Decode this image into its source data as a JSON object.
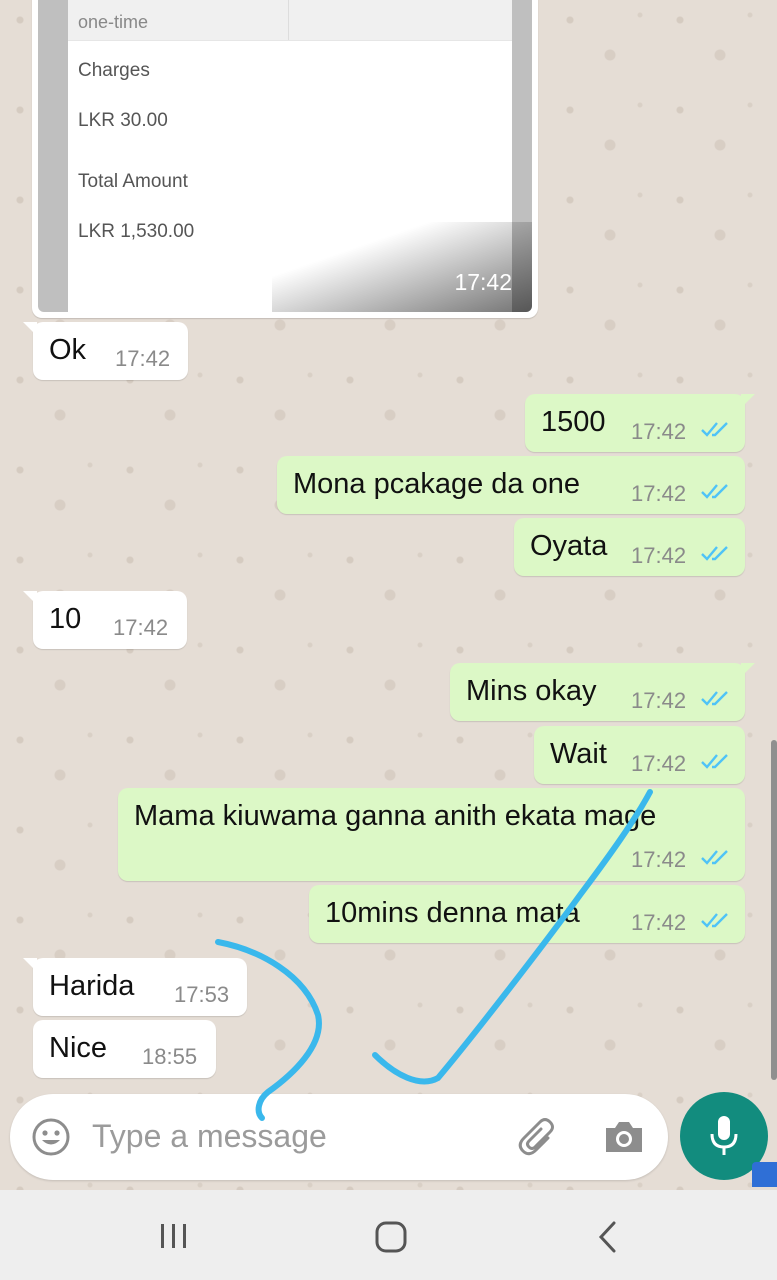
{
  "receipt": {
    "top_value": "one-time",
    "charges_label": "Charges",
    "charges_value": "LKR 30.00",
    "total_label": "Total Amount",
    "total_value": "LKR 1,530.00",
    "time": "17:42"
  },
  "messages": [
    {
      "text": "Ok",
      "time": "17:42",
      "dir": "in"
    },
    {
      "text": "1500",
      "time": "17:42",
      "dir": "out"
    },
    {
      "text": "Mona pcakage da one",
      "time": "17:42",
      "dir": "out"
    },
    {
      "text": "Oyata",
      "time": "17:42",
      "dir": "out"
    },
    {
      "text": "10",
      "time": "17:42",
      "dir": "in"
    },
    {
      "text": "Mins okay",
      "time": "17:42",
      "dir": "out"
    },
    {
      "text": "Wait",
      "time": "17:42",
      "dir": "out"
    },
    {
      "text": "Mama kiuwama ganna anith ekata mage",
      "time": "17:42",
      "dir": "out"
    },
    {
      "text": "10mins denna mata",
      "time": "17:42",
      "dir": "out"
    },
    {
      "text": "Harida",
      "time": "17:53",
      "dir": "in"
    },
    {
      "text": "Nice",
      "time": "18:55",
      "dir": "in"
    }
  ],
  "composer": {
    "placeholder": "Type a message",
    "icons": [
      "emoji-icon",
      "paperclip-icon",
      "camera-icon",
      "microphone-icon"
    ]
  },
  "colors": {
    "incoming": "#ffffff",
    "outgoing": "#dcf8c6",
    "accent": "#128c7e",
    "read_ticks": "#4fc3f7",
    "annotation": "#3ab8ec"
  },
  "nav": {
    "icons": [
      "recent-apps-icon",
      "home-icon",
      "back-icon"
    ]
  }
}
